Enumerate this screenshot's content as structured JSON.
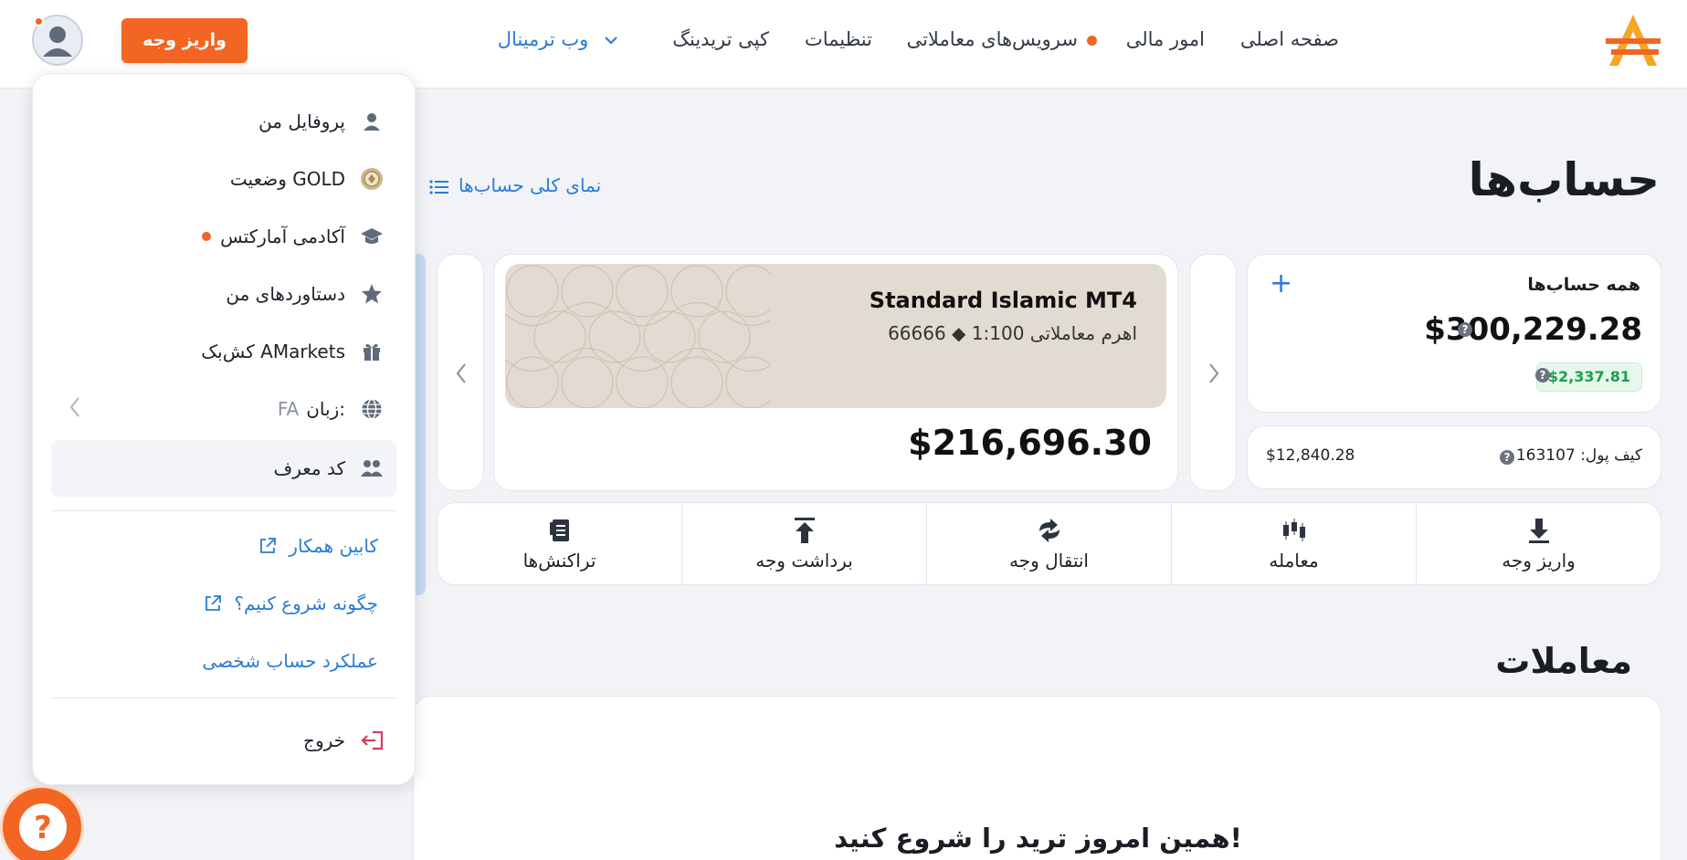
{
  "header": {
    "nav": {
      "home": "صفحه اصلی",
      "finance": "امور مالی",
      "trading_services": "سرویس‌های معاملاتی",
      "settings": "تنظیمات",
      "copy_trading": "کپی تریدینگ",
      "web_terminal": "وب ترمینال"
    },
    "deposit_button": "واریز وجه"
  },
  "page": {
    "title": "حساب‌ها",
    "overview_link": "نمای کلی حساب‌ها"
  },
  "all_accounts": {
    "label": "همه حساب‌ها",
    "add": "+",
    "total_balance": "$300,229.28",
    "profit": "$2,337.81",
    "help": "?"
  },
  "wallet": {
    "label": "کیف پول: 163107",
    "balance": "$12,840.28"
  },
  "account": {
    "name": "Standard Islamic MT4",
    "sub": "66666 ◆ اهرم معاملاتی 1:100",
    "balance": "$216,696.30"
  },
  "actions": [
    {
      "label": "واریز وجه",
      "icon": "download-icon"
    },
    {
      "label": "معامله",
      "icon": "candles-icon"
    },
    {
      "label": "انتقال وجه",
      "icon": "transfer-icon"
    },
    {
      "label": "برداشت وجه",
      "icon": "upload-icon"
    },
    {
      "label": "تراکنش‌ها",
      "icon": "document-icon"
    }
  ],
  "trades": {
    "title": "معاملات",
    "cta": "همین امروز ترید را شروع کنید!"
  },
  "menu": {
    "profile": "پروفایل من",
    "gold_status": "وضعیت GOLD",
    "academy": "آکادمی آمارکتس",
    "achievements": "دستاوردهای من",
    "cashback": "کش‌بک AMarkets",
    "language_label": "زبان:",
    "language_code": "FA",
    "referral": "کد معرف",
    "partner_cabinet": "کابین همکار",
    "how_to_start": "چگونه شروع کنیم؟",
    "personal_performance": "عملکرد حساب شخصی",
    "logout": "خروج"
  },
  "help_bubble": "?",
  "colors": {
    "brand_orange": "#f26522",
    "link_blue": "#2b7bd6",
    "profit_green": "#1f9e4a",
    "logout_red": "#d63a5a"
  }
}
